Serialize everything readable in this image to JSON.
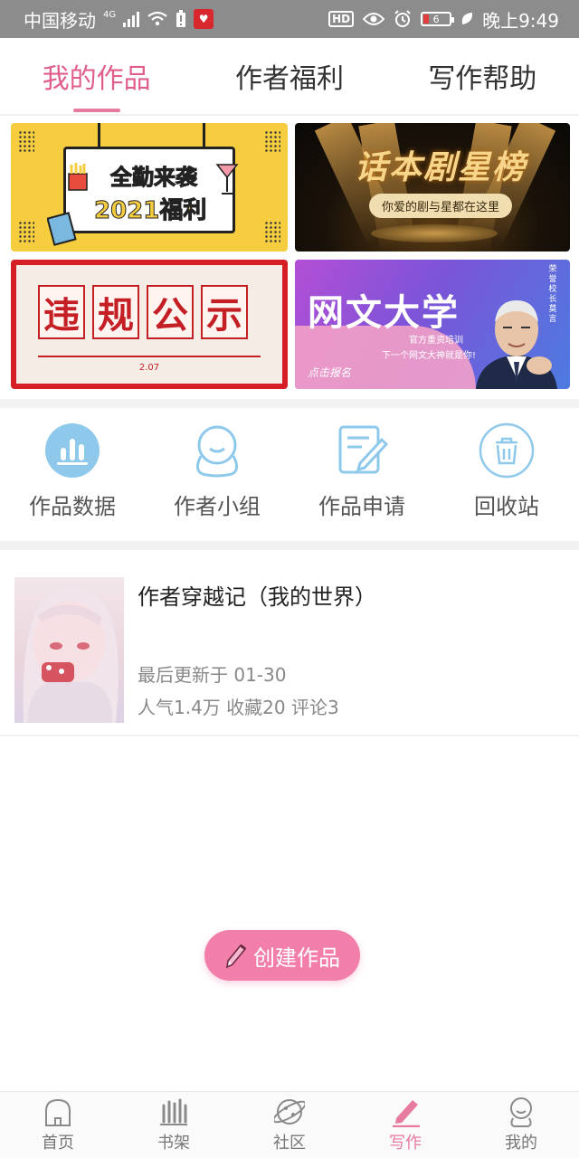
{
  "status_bar": {
    "carrier": "中国移动",
    "network": "4G",
    "battery_level": "6",
    "time": "晚上9:49",
    "hd_label": "HD"
  },
  "tabs": [
    {
      "label": "我的作品",
      "active": true
    },
    {
      "label": "作者福利",
      "active": false
    },
    {
      "label": "写作帮助",
      "active": false
    }
  ],
  "banners": {
    "welfare": {
      "line1": "全勤来袭",
      "line2": "2021福利"
    },
    "star_list": {
      "title": "话本剧星榜",
      "subtitle": "你爱的剧与星都在这里"
    },
    "violation": {
      "chars": [
        "违",
        "规",
        "公",
        "示"
      ],
      "date": "2.07"
    },
    "university": {
      "title": "网文大学",
      "line1": "官方重资培训",
      "line2": "下一个网文大神就是你!",
      "cta": "点击报名",
      "side": "荣誉校长 莫言"
    }
  },
  "actions": [
    {
      "label": "作品数据",
      "icon": "bar-chart-icon"
    },
    {
      "label": "作者小组",
      "icon": "group-icon"
    },
    {
      "label": "作品申请",
      "icon": "edit-document-icon"
    },
    {
      "label": "回收站",
      "icon": "trash-icon"
    }
  ],
  "work": {
    "title": "作者穿越记（我的世界）",
    "updated": "最后更新于 01-30",
    "stats": "人气1.4万 收藏20 评论3"
  },
  "create_button": {
    "label": "创建作品"
  },
  "bottom_nav": [
    {
      "label": "首页",
      "icon": "home-icon",
      "active": false
    },
    {
      "label": "书架",
      "icon": "bookshelf-icon",
      "active": false
    },
    {
      "label": "社区",
      "icon": "community-icon",
      "active": false
    },
    {
      "label": "写作",
      "icon": "pen-icon",
      "active": true
    },
    {
      "label": "我的",
      "icon": "profile-icon",
      "active": false
    }
  ],
  "colors": {
    "accent": "#e77a9f",
    "button": "#f27fa9",
    "icon_blue": "#8ec9ec"
  }
}
